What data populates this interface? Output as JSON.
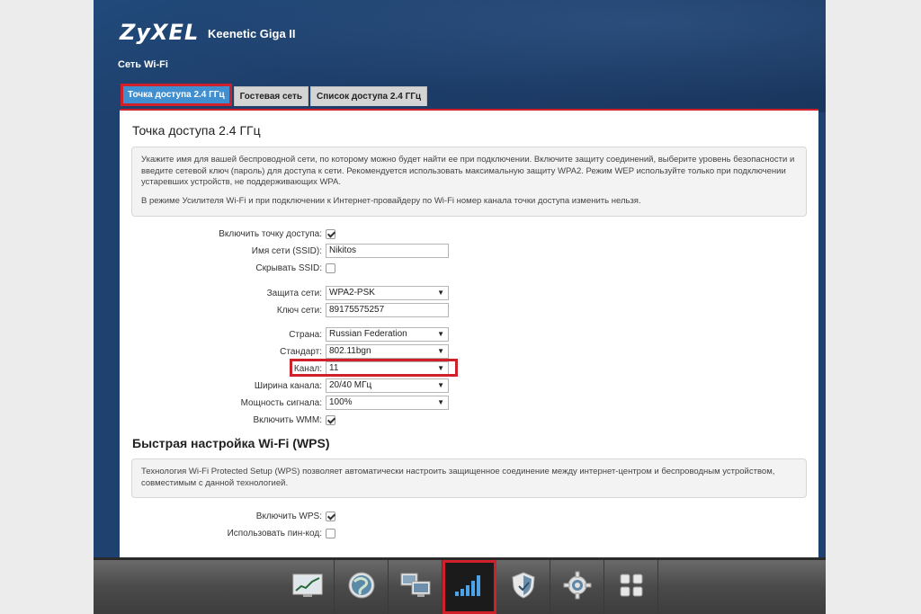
{
  "header": {
    "brand": "ZyXEL",
    "model": "Keenetic Giga II",
    "section": "Сеть Wi-Fi"
  },
  "tabs": [
    {
      "label": "Точка доступа 2.4 ГГц",
      "active": true
    },
    {
      "label": "Гостевая сеть",
      "active": false
    },
    {
      "label": "Список доступа 2.4 ГГц",
      "active": false
    }
  ],
  "panel": {
    "title": "Точка доступа 2.4 ГГц",
    "info_p1": "Укажите имя для вашей беспроводной сети, по которому можно будет найти ее при подключении. Включите защиту соединений, выберите уровень безопасности и введите сетевой ключ (пароль) для доступа к сети. Рекомендуется использовать максимальную защиту WPA2. Режим WEP используйте только при подключении устаревших устройств, не поддерживающих WPA.",
    "info_p2": "В режиме Усилителя Wi-Fi и при подключении к Интернет-провайдеру по Wi-Fi номер канала точки доступа изменить нельзя.",
    "fields": {
      "enable_ap": {
        "label": "Включить точку доступа:",
        "checked": true
      },
      "ssid": {
        "label": "Имя сети (SSID):",
        "value": "Nikitos"
      },
      "hide_ssid": {
        "label": "Скрывать SSID:",
        "checked": false
      },
      "security": {
        "label": "Защита сети:",
        "value": "WPA2-PSK"
      },
      "key": {
        "label": "Ключ сети:",
        "value": "89175575257"
      },
      "country": {
        "label": "Страна:",
        "value": "Russian Federation"
      },
      "standard": {
        "label": "Стандарт:",
        "value": "802.11bgn"
      },
      "channel": {
        "label": "Канал:",
        "value": "11"
      },
      "width": {
        "label": "Ширина канала:",
        "value": "20/40 МГц"
      },
      "power": {
        "label": "Мощность сигнала:",
        "value": "100%"
      },
      "wmm": {
        "label": "Включить WMM:",
        "checked": true
      }
    },
    "wps_title": "Быстрая настройка Wi-Fi (WPS)",
    "wps_info": "Технология Wi-Fi Protected Setup (WPS) позволяет автоматически настроить защищенное соединение между интернет-центром и беспроводным устройством, совместимым с данной технологией.",
    "wps_fields": {
      "enable_wps": {
        "label": "Включить WPS:",
        "checked": true
      },
      "use_pin": {
        "label": "Использовать пин-код:",
        "checked": false
      }
    }
  },
  "dock": [
    {
      "icon": "monitor-chart-icon",
      "active": false
    },
    {
      "icon": "globe-icon",
      "active": false
    },
    {
      "icon": "network-computers-icon",
      "active": false
    },
    {
      "icon": "wifi-signal-icon",
      "active": true
    },
    {
      "icon": "shield-icon",
      "active": false
    },
    {
      "icon": "gear-icon",
      "active": false
    },
    {
      "icon": "apps-grid-icon",
      "active": false
    }
  ],
  "colors": {
    "header": "#1f416f",
    "tab_active": "#3f8fd1",
    "highlight": "#d0202a",
    "dock": "#4a4a4a"
  }
}
